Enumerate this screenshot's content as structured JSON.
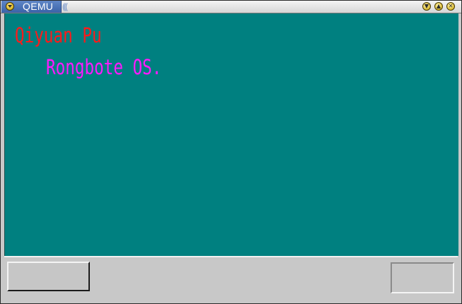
{
  "window": {
    "title": "QEMU",
    "title_grip": "(((",
    "controls": {
      "menu_icon": "window-menu-icon",
      "minimize_icon": "minimize-icon",
      "maximize_icon": "maximize-icon",
      "close_icon": "close-icon"
    }
  },
  "display": {
    "background_color": "#008080",
    "lines": [
      {
        "text": "Qiyuan Pu",
        "color": "#ff1a1a"
      },
      {
        "text": "Rongbote OS.",
        "color": "#ff1aff"
      }
    ]
  }
}
